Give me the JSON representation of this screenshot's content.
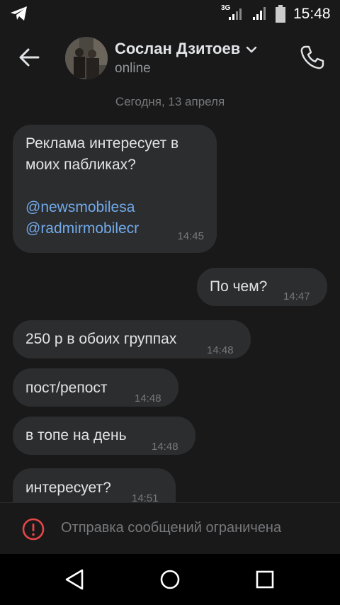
{
  "status_bar": {
    "time": "15:48",
    "network": "3G"
  },
  "header": {
    "contact_name": "Сослан Дзитоев",
    "presence": "online"
  },
  "chat": {
    "date_separator": "Сегодня, 13 апреля",
    "messages": [
      {
        "direction": "incoming",
        "lines": [
          "Реклама интересует в",
          "моих пабликах?"
        ],
        "links": [
          "@newsmobilesa",
          "@radmirmobilecr"
        ],
        "time": "14:45"
      },
      {
        "direction": "outgoing",
        "text": "По чем?",
        "time": "14:47"
      },
      {
        "direction": "incoming",
        "text": "250 р в обоих группах",
        "time": "14:48"
      },
      {
        "direction": "incoming",
        "text": "пост/репост",
        "time": "14:48"
      },
      {
        "direction": "incoming",
        "text": "в топе на день",
        "time": "14:48"
      },
      {
        "direction": "incoming",
        "text": "интересует?",
        "time": "14:51"
      }
    ]
  },
  "composer": {
    "restriction_text": "Отправка сообщений ограничена"
  },
  "colors": {
    "background": "#19191a",
    "bubble": "#2c2d2e",
    "link": "#71aaeb",
    "warning": "#e64646",
    "muted": "#76787a"
  },
  "icons": {
    "back": "arrow-left-icon",
    "call": "phone-icon",
    "warning": "exclamation-circle-icon",
    "nav_back": "triangle-back-icon",
    "nav_home": "circle-home-icon",
    "nav_recents": "square-recents-icon"
  }
}
